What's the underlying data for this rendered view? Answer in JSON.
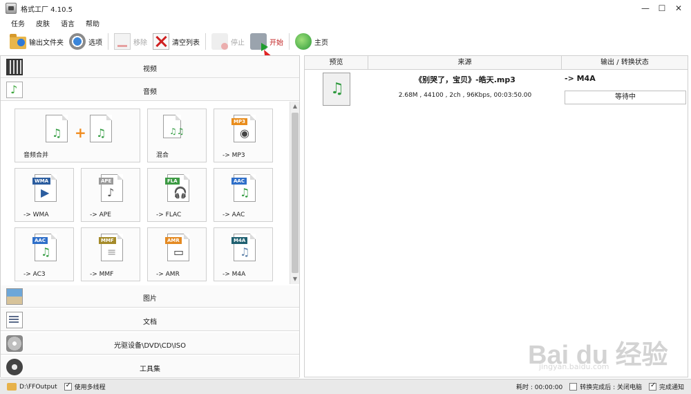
{
  "app": {
    "title": "格式工厂 4.10.5"
  },
  "window_controls": [
    "—",
    "☐",
    "✕"
  ],
  "menu": [
    "任务",
    "皮肤",
    "语言",
    "帮助"
  ],
  "toolbar": {
    "output_folder": "输出文件夹",
    "options": "选项",
    "remove": "移除",
    "clear_list": "清空列表",
    "stop": "停止",
    "start": "开始",
    "home": "主页"
  },
  "categories": {
    "video": "视频",
    "audio": "音频",
    "picture": "图片",
    "document": "文档",
    "disc": "光驱设备\\DVD\\CD\\ISO",
    "tools": "工具集"
  },
  "audio_tiles": [
    {
      "label": "音频合并",
      "badge": ""
    },
    {
      "label": "混合",
      "badge": ""
    },
    {
      "label": "-> MP3",
      "badge": "MP3"
    },
    {
      "label": "-> WMA",
      "badge": "WMA"
    },
    {
      "label": "-> APE",
      "badge": "APE"
    },
    {
      "label": "-> FLAC",
      "badge": "FLA"
    },
    {
      "label": "-> AAC",
      "badge": "AAC"
    },
    {
      "label": "-> AC3",
      "badge": "AAC"
    },
    {
      "label": "-> MMF",
      "badge": "MMF"
    },
    {
      "label": "-> AMR",
      "badge": "AMR"
    },
    {
      "label": "-> M4A",
      "badge": "M4A"
    }
  ],
  "table": {
    "headers": [
      "预览",
      "来源",
      "输出 / 转换状态"
    ],
    "row": {
      "title": "《别哭了，宝贝》-皓天.mp3",
      "info": "2.68M , 44100 , 2ch , 96Kbps, 00:03:50.00",
      "output": "-> M4A",
      "status": "等待中"
    }
  },
  "statusbar": {
    "output_path": "D:\\FFOutput",
    "multithread": "使用多线程",
    "elapsed": "耗时 : 00:00:00",
    "after_done": "转换完成后 : 关闭电脑",
    "notify": "完成通知"
  },
  "watermark": {
    "main": "Bai du 经验",
    "sub": "jingyan.baidu.com"
  }
}
